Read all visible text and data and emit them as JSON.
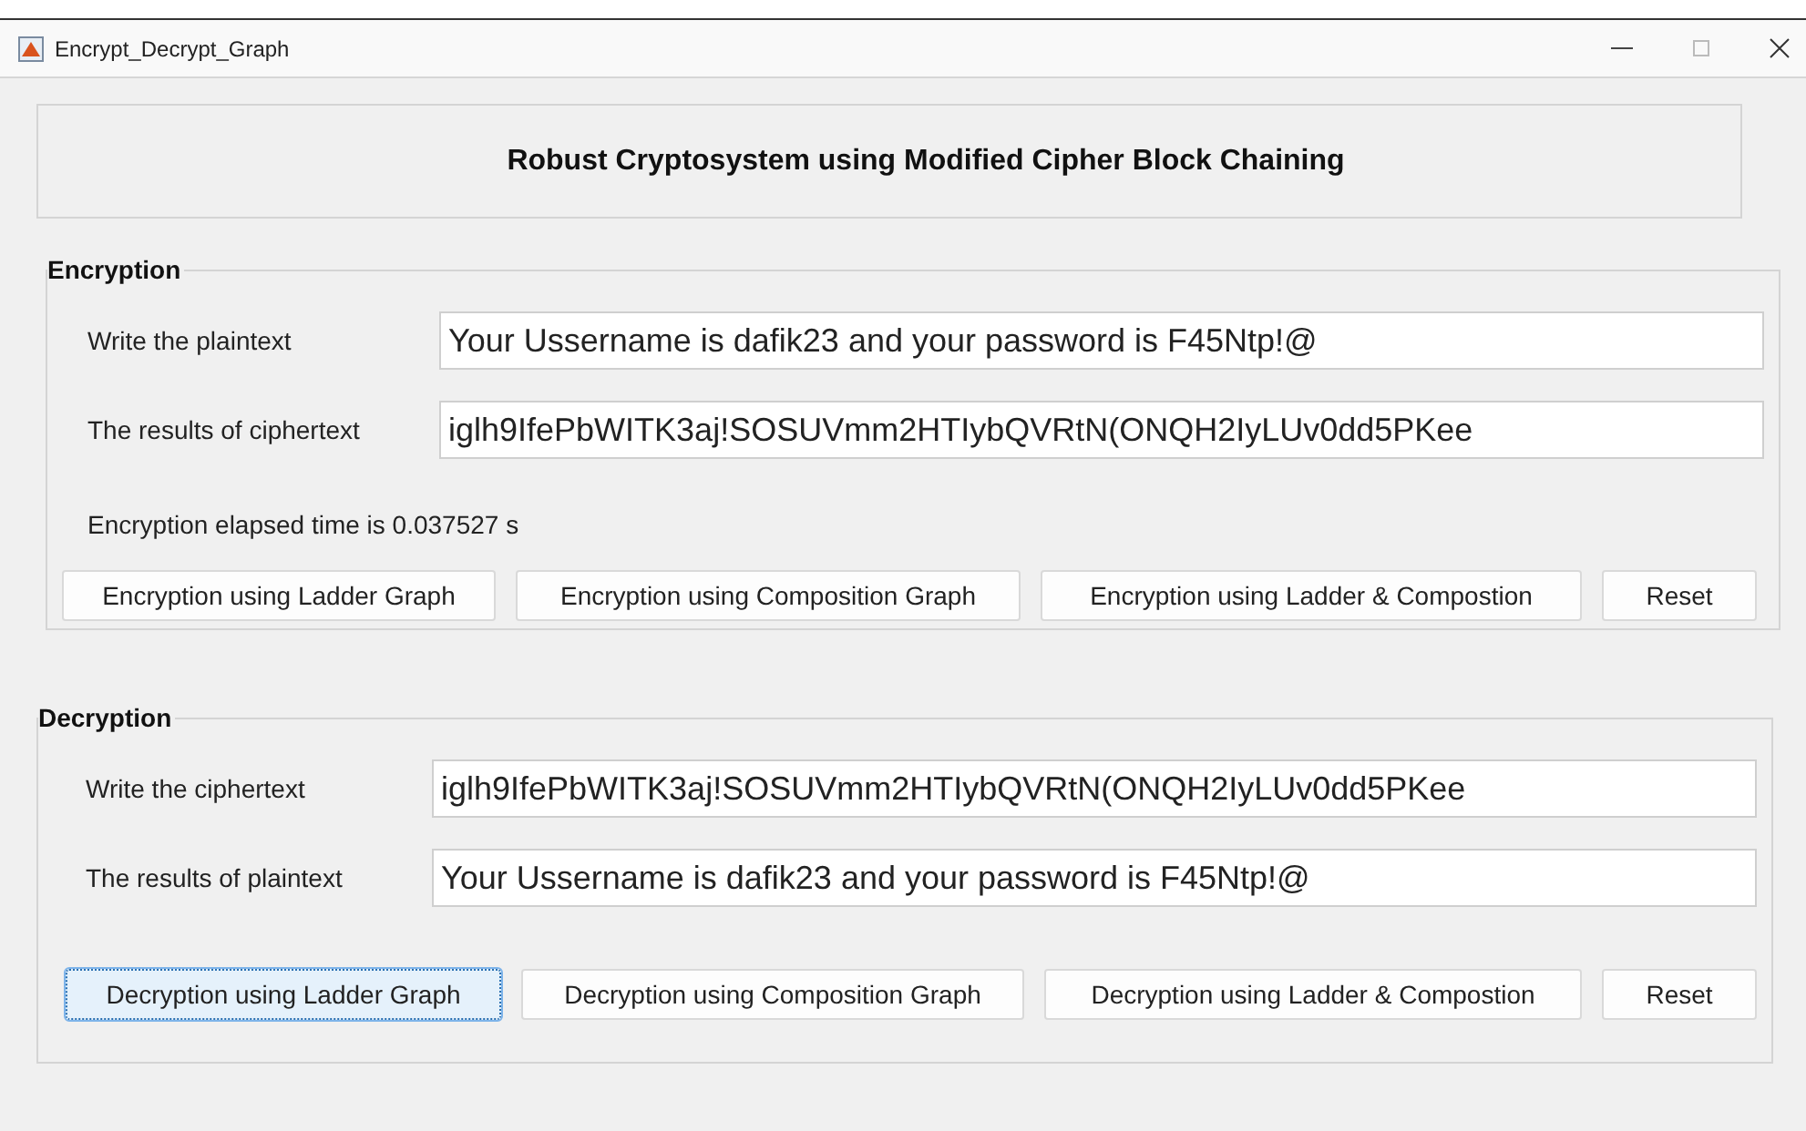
{
  "window": {
    "title": "Encrypt_Decrypt_Graph"
  },
  "header": {
    "title": "Robust Cryptosystem using Modified Cipher Block Chaining"
  },
  "encryption": {
    "legend": "Encryption",
    "fields": [
      {
        "label": "Write the plaintext",
        "value": "Your Ussername is dafik23 and your password is F45Ntp!@"
      },
      {
        "label": "The results of ciphertext",
        "value": "iglh9IfePbWITK3aj!SOSUVmm2HTIybQVRtN(ONQH2IyLUv0dd5PKee"
      }
    ],
    "status": "Encryption elapsed time is 0.037527 s",
    "buttons": [
      {
        "label": "Encryption using Ladder Graph",
        "focused": false
      },
      {
        "label": "Encryption using Composition Graph",
        "focused": false
      },
      {
        "label": "Encryption using Ladder & Compostion",
        "focused": false
      },
      {
        "label": "Reset",
        "focused": false
      }
    ]
  },
  "decryption": {
    "legend": "Decryption",
    "fields": [
      {
        "label": "Write the ciphertext",
        "value": "iglh9IfePbWITK3aj!SOSUVmm2HTIybQVRtN(ONQH2IyLUv0dd5PKee"
      },
      {
        "label": "The results of plaintext",
        "value": "Your Ussername is dafik23 and your password is F45Ntp!@"
      }
    ],
    "buttons": [
      {
        "label": "Decryption using Ladder Graph",
        "focused": true
      },
      {
        "label": "Decryption using Composition Graph",
        "focused": false
      },
      {
        "label": "Decryption using Ladder & Compostion",
        "focused": false
      },
      {
        "label": "Reset",
        "focused": false
      }
    ]
  }
}
